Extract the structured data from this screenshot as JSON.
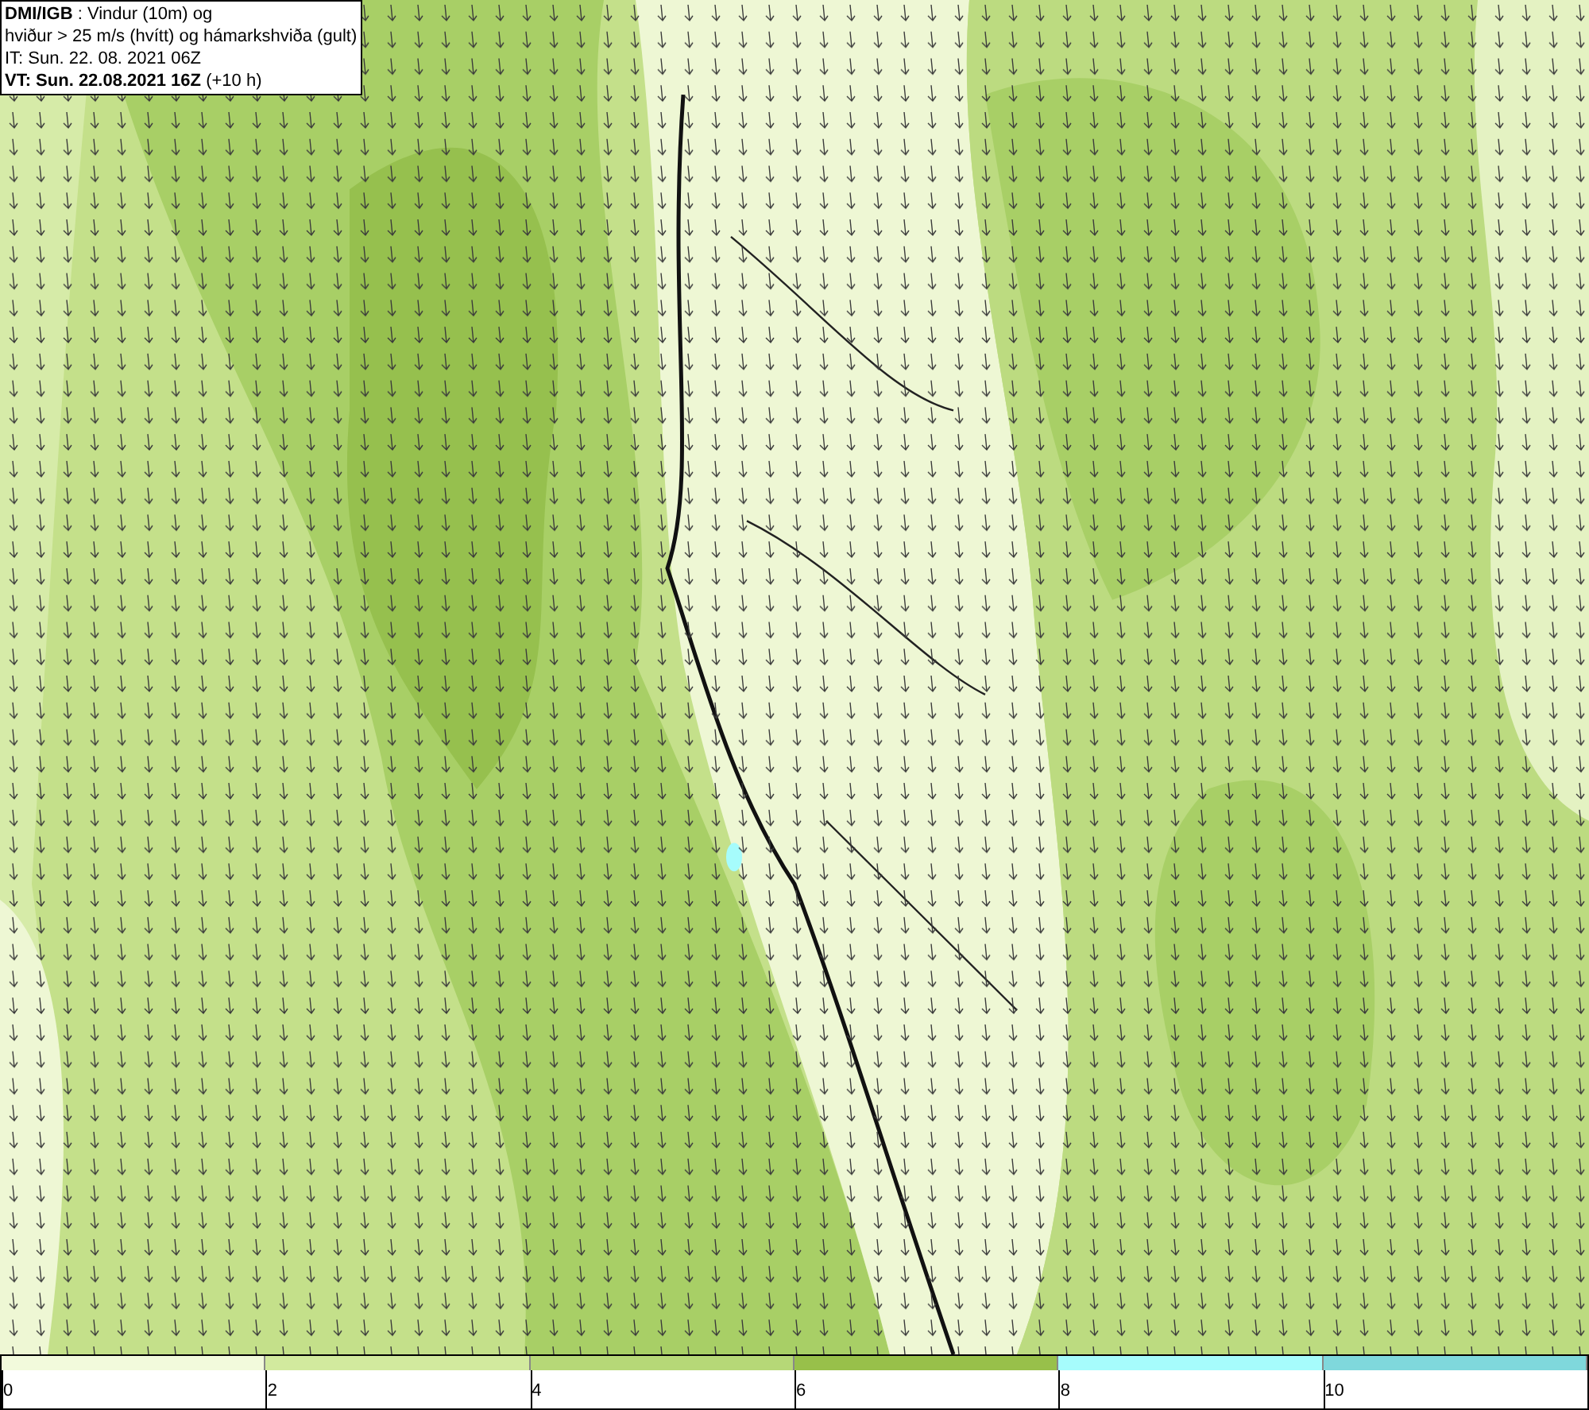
{
  "header": {
    "lines": [
      "**DMI/IGB** : Vindur (10m) og",
      "hviður > 25 m/s (hvítt) og hámarkshviða (gult)",
      "IT: Sun. 22. 08. 2021 06Z",
      "**VT: Sun. 22.08.2021 16Z** (+10 h)"
    ]
  },
  "legend": {
    "segments": [
      {
        "color": "#f2fadc"
      },
      {
        "color": "#d2ea9e"
      },
      {
        "color": "#b6d877"
      },
      {
        "color": "#98c04a"
      },
      {
        "color": "#a6fcfc"
      },
      {
        "color": "#7fd8dc"
      }
    ],
    "ticks": [
      "0",
      "2",
      "4",
      "6",
      "8",
      "10"
    ]
  }
}
